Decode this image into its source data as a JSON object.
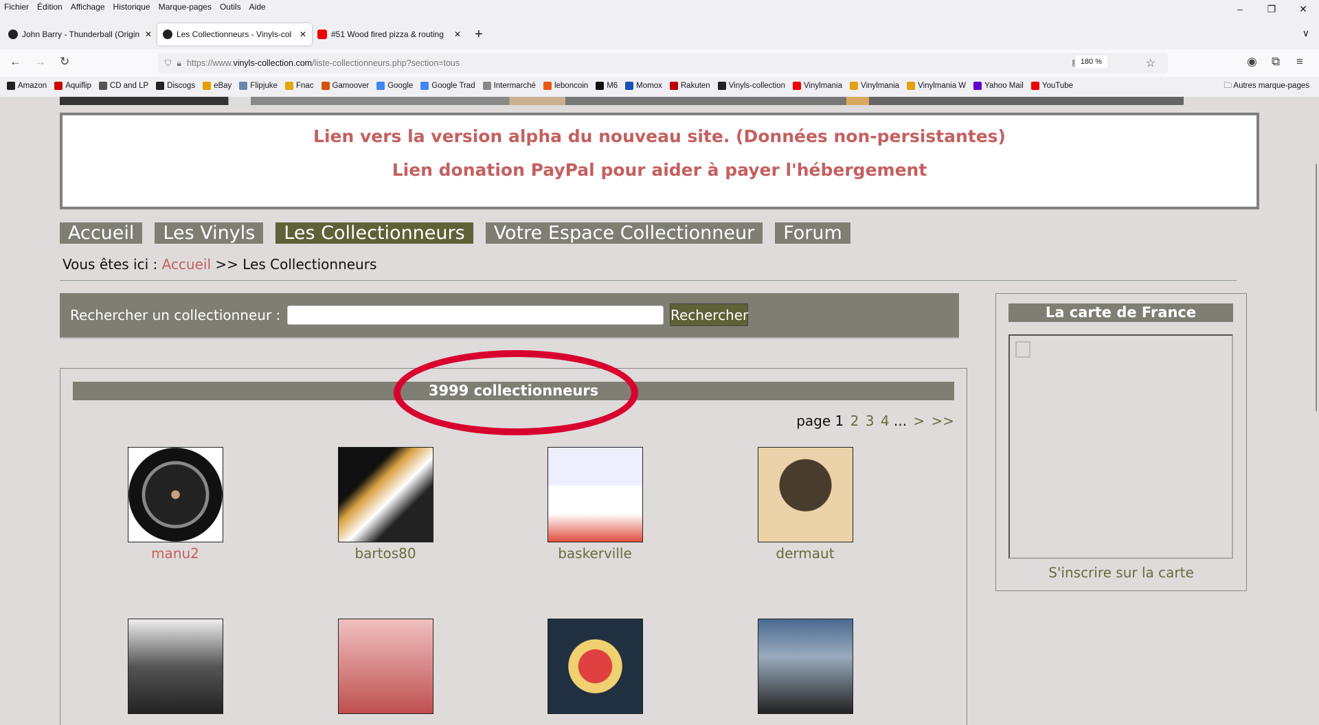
{
  "browser": {
    "menu": [
      "Fichier",
      "Édition",
      "Affichage",
      "Historique",
      "Marque-pages",
      "Outils",
      "Aide"
    ],
    "tabs": [
      {
        "title": "John Barry - Thunderball (Origin",
        "icon": "discogs-icon"
      },
      {
        "title": "Les Collectionneurs - Vinyls-col",
        "icon": "vinyl-icon",
        "active": true
      },
      {
        "title": "#51 Wood fired pizza & routing",
        "icon": "youtube-icon"
      }
    ],
    "url_prefix": "https://www.",
    "url_host": "vinyls-collection.com",
    "url_path": "/liste-collectionneurs.php?section=tous",
    "zoom": "180 %",
    "bookmarks": [
      {
        "label": "Amazon",
        "color": "#222"
      },
      {
        "label": "Aquiflip",
        "color": "#c00"
      },
      {
        "label": "CD and LP",
        "color": "#555"
      },
      {
        "label": "Discogs",
        "color": "#222"
      },
      {
        "label": "eBay",
        "color": "#e5a000"
      },
      {
        "label": "Flipjuke",
        "color": "#6688aa"
      },
      {
        "label": "Fnac",
        "color": "#e1a70e"
      },
      {
        "label": "Gamoover",
        "color": "#d5520a"
      },
      {
        "label": "Google",
        "color": "#4285f4"
      },
      {
        "label": "Google Trad",
        "color": "#4285f4"
      },
      {
        "label": "Intermarché",
        "color": "#888"
      },
      {
        "label": "leboncoin",
        "color": "#e65b10"
      },
      {
        "label": "M6",
        "color": "#111"
      },
      {
        "label": "Momox",
        "color": "#1a4fb5"
      },
      {
        "label": "Rakuten",
        "color": "#bf0000"
      },
      {
        "label": "Vinyls-collection",
        "color": "#222"
      },
      {
        "label": "Vinylmania",
        "color": "#e00"
      },
      {
        "label": "Vinylmania",
        "color": "#e3a010"
      },
      {
        "label": "Vinylmania W",
        "color": "#e3a010"
      },
      {
        "label": "Yahoo Mail",
        "color": "#6001d2"
      },
      {
        "label": "YouTube",
        "color": "#e00"
      }
    ],
    "other_bookmarks": "Autres marque-pages"
  },
  "notice": {
    "line1": "Lien vers la version alpha du nouveau site. (Données non-persistantes)",
    "line2": "Lien donation PayPal pour aider à payer l'hébergement"
  },
  "nav": [
    {
      "label": "Accueil"
    },
    {
      "label": "Les Vinyls"
    },
    {
      "label": "Les Collectionneurs",
      "active": true
    },
    {
      "label": "Votre Espace Collectionneur"
    },
    {
      "label": "Forum"
    }
  ],
  "breadcrumb": {
    "prefix": "Vous êtes ici : ",
    "home": "Accueil",
    "sep": " >> ",
    "current": "Les Collectionneurs"
  },
  "search": {
    "label": "Rechercher un collectionneur :",
    "value": "",
    "button": "Rechercher"
  },
  "results": {
    "count_label": "3999 collectionneurs",
    "pager": {
      "prefix": "page",
      "current": "1",
      "pages": [
        "2",
        "3",
        "4"
      ],
      "ellipsis": "...",
      "next": ">",
      "last": ">>"
    },
    "members": [
      {
        "name": "manu2",
        "visited": true
      },
      {
        "name": "bartos80"
      },
      {
        "name": "baskerville"
      },
      {
        "name": "dermaut"
      },
      {
        "name": ""
      },
      {
        "name": ""
      },
      {
        "name": ""
      },
      {
        "name": ""
      }
    ]
  },
  "sidebar": {
    "title": "La carte de France",
    "link": "S'inscrire sur la carte"
  },
  "colors": {
    "tab": "#807d73",
    "tab_active": "#5f6136",
    "link": "#c46060",
    "annotation": "#d8002e"
  }
}
